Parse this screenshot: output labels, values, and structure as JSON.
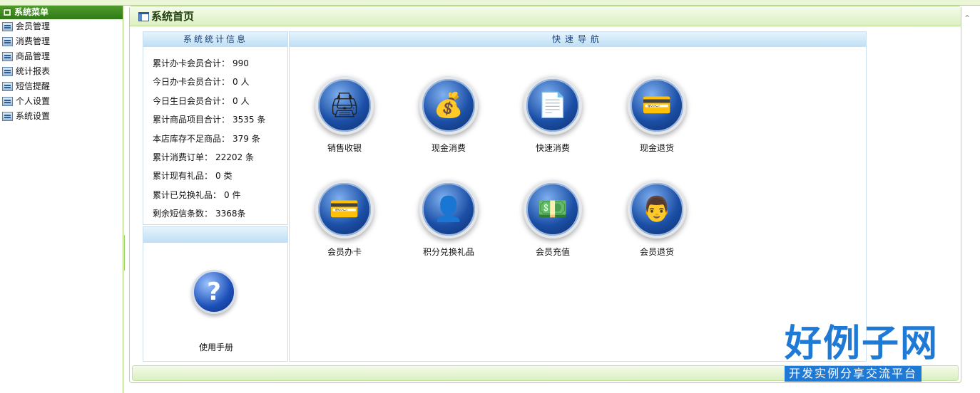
{
  "sidebar": {
    "header": "系统菜单",
    "items": [
      {
        "label": "会员管理"
      },
      {
        "label": "消费管理"
      },
      {
        "label": "商品管理"
      },
      {
        "label": "统计报表"
      },
      {
        "label": "短信提醒"
      },
      {
        "label": "个人设置"
      },
      {
        "label": "系统设置"
      }
    ]
  },
  "main": {
    "title": "系统首页"
  },
  "stats": {
    "header": "系统统计信息",
    "rows": [
      {
        "label": "累计办卡会员合计：",
        "value": "990"
      },
      {
        "label": "今日办卡会员合计：",
        "value": "0 人"
      },
      {
        "label": "今日生日会员合计：",
        "value": "0 人"
      },
      {
        "label": "累计商品项目合计：",
        "value": "3535 条"
      },
      {
        "label": "本店库存不足商品：",
        "value": "379 条"
      },
      {
        "label": "累计消费订单：",
        "value": "22202 条"
      },
      {
        "label": "累计现有礼品：",
        "value": "0 类"
      },
      {
        "label": "累计已兑换礼品：",
        "value": "0 件"
      },
      {
        "label": "剩余短信条数：",
        "value": "3368条"
      }
    ]
  },
  "help": {
    "label": "使用手册",
    "icon": "question-icon"
  },
  "quick_nav": {
    "header": "快速导航",
    "buttons": [
      {
        "label": "销售收银",
        "icon": "cash-register-icon"
      },
      {
        "label": "现金消费",
        "icon": "coins-icon"
      },
      {
        "label": "快速消费",
        "icon": "documents-icon"
      },
      {
        "label": "现金退货",
        "icon": "card-return-icon"
      },
      {
        "label": "会员办卡",
        "icon": "member-card-icon"
      },
      {
        "label": "积分兑换礼品",
        "icon": "user-check-icon"
      },
      {
        "label": "会员充值",
        "icon": "recharge-icon"
      },
      {
        "label": "会员退货",
        "icon": "member-return-icon"
      }
    ]
  },
  "brand": {
    "main": "好例子网",
    "sub": "开发实例分享交流平台"
  },
  "colors": {
    "sidebar_header": "#2f7a16",
    "panel_header": "#bfe0f6",
    "brand": "#1f7ad6"
  }
}
